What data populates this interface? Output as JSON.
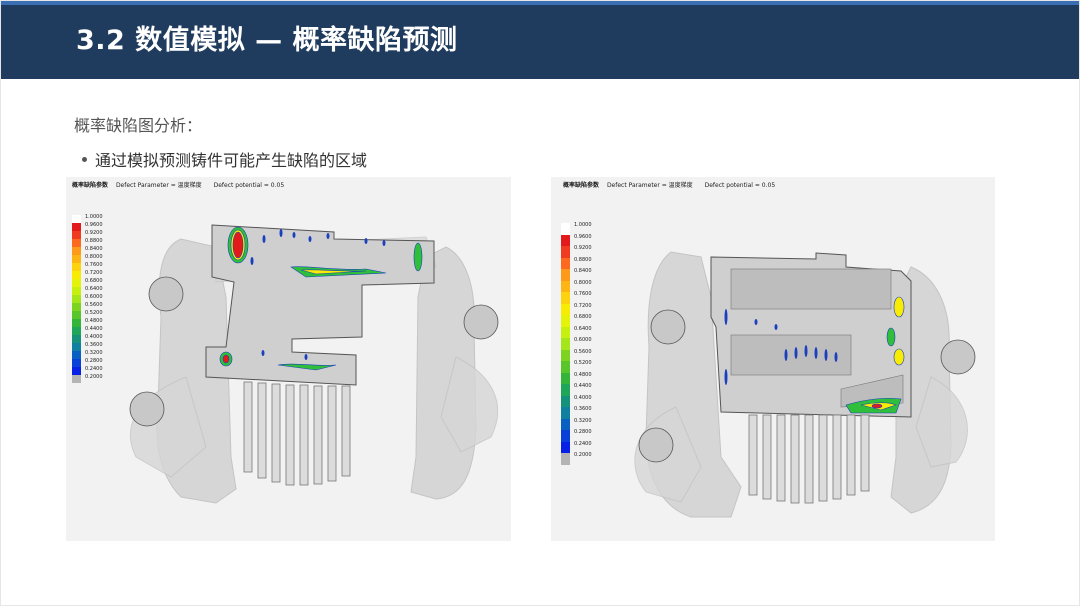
{
  "header": {
    "title": "3.2 数值模拟 — 概率缺陷预测",
    "bar_color": "#1f3b5e",
    "stripe_color": "#3b6fb4"
  },
  "content": {
    "section_label": "概率缺陷图分析：",
    "bullet": "通过模拟预测铸件可能产生缺陷的区域"
  },
  "simulations": [
    {
      "title": "概率缺陷参数",
      "param": "Defect Parameter = 温度梯度",
      "potential": "Defect potential = 0.05",
      "legend_values": [
        "1.0000",
        "0.9600",
        "0.9200",
        "0.8800",
        "0.8400",
        "0.8000",
        "0.7600",
        "0.7200",
        "0.6800",
        "0.6400",
        "0.6000",
        "0.5600",
        "0.5200",
        "0.4800",
        "0.4400",
        "0.4000",
        "0.3600",
        "0.3200",
        "0.2800",
        "0.2400",
        "0.2000"
      ]
    },
    {
      "title": "概率缺陷参数",
      "param": "Defect Parameter = 温度梯度",
      "potential": "Defect potential = 0.05",
      "legend_values": [
        "1.0000",
        "0.9600",
        "0.9200",
        "0.8800",
        "0.8400",
        "0.8000",
        "0.7600",
        "0.7200",
        "0.6800",
        "0.6400",
        "0.6000",
        "0.5600",
        "0.5200",
        "0.4800",
        "0.4400",
        "0.4000",
        "0.3600",
        "0.3200",
        "0.2800",
        "0.2400",
        "0.2000"
      ]
    }
  ],
  "legend_colors": [
    "#ffffff",
    "#e31a1c",
    "#f03b20",
    "#fd6a1f",
    "#fe9a1a",
    "#fdb515",
    "#fdd20e",
    "#f8ec05",
    "#e5f20a",
    "#c8f00f",
    "#a4e61a",
    "#7ed321",
    "#58c62b",
    "#34b53a",
    "#1fa65a",
    "#17927a",
    "#1080a0",
    "#0a60c0",
    "#0840d8",
    "#0620e6",
    "#b4b4b4"
  ]
}
